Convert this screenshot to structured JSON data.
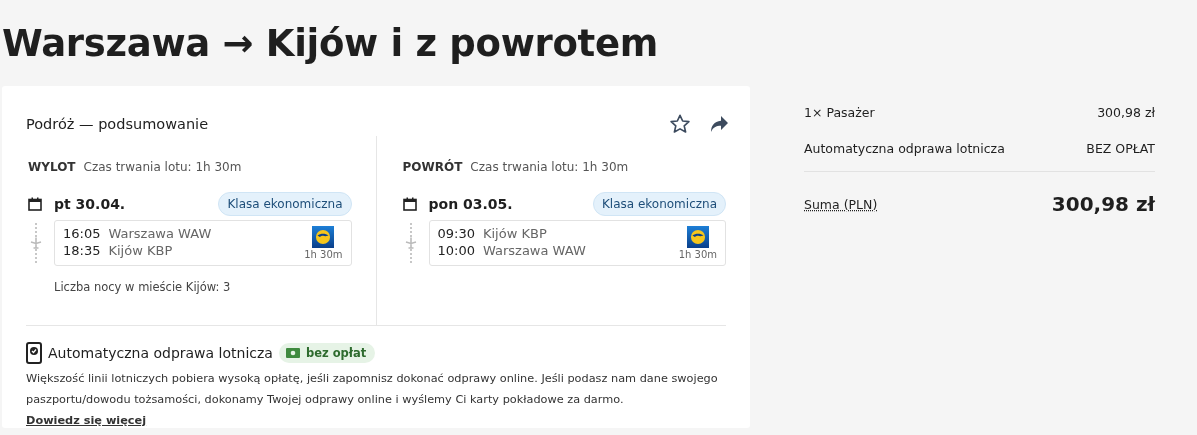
{
  "title": "Warszawa → Kijów i z powrotem",
  "trip": {
    "heading": "Podróż — podsumowanie",
    "legs": [
      {
        "label": "WYLOT",
        "duration": "Czas trwania lotu: 1h 30m",
        "date": "pt 30.04.",
        "cabin": "Klasa ekonomiczna",
        "depart_time": "16:05",
        "depart_place": "Warszawa WAW",
        "arrive_time": "18:35",
        "arrive_place": "Kijów KBP",
        "flight_duration": "1h 30m",
        "note": "Liczba nocy w mieście Kijów: 3"
      },
      {
        "label": "POWRÓT",
        "duration": "Czas trwania lotu: 1h 30m",
        "date": "pon 03.05.",
        "cabin": "Klasa ekonomiczna",
        "depart_time": "09:30",
        "depart_place": "Kijów KBP",
        "arrive_time": "10:00",
        "arrive_place": "Warszawa WAW",
        "flight_duration": "1h 30m"
      }
    ]
  },
  "checkin": {
    "title": "Automatyczna odprawa lotnicza",
    "badge": "bez opłat",
    "text": "Większość linii lotniczych pobiera wysoką opłatę, jeśli zapomnisz dokonać odprawy online. Jeśli podasz nam dane swojego paszportu/dowodu tożsamości, dokonamy Twojej odprawy online i wyślemy Ci karty pokładowe za darmo.",
    "link": "Dowiedz się więcej"
  },
  "summary": {
    "rows": [
      {
        "label": "1× Pasażer",
        "value": "300,98 zł"
      },
      {
        "label": "Automatyczna odprawa lotnicza",
        "value": "BEZ OPŁAT"
      }
    ],
    "total_label": "Suma (PLN)",
    "total": "300,98 zł"
  }
}
